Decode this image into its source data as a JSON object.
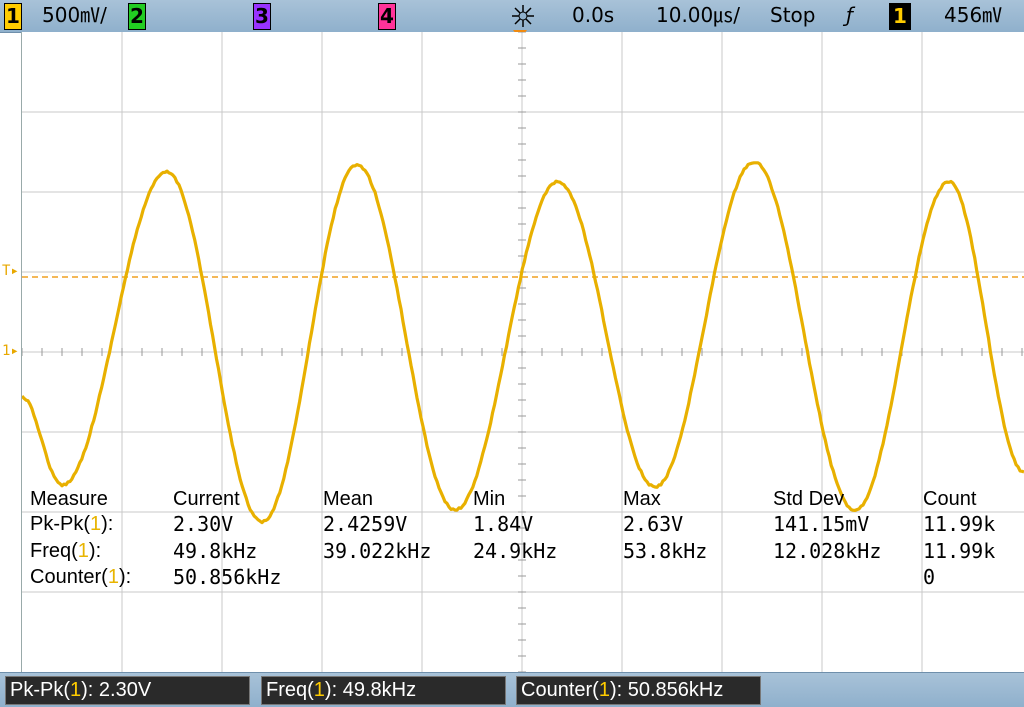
{
  "topbar": {
    "ch1_num": "1",
    "ch1_scale": "500㎷/",
    "ch2_num": "2",
    "ch3_num": "3",
    "ch4_num": "4",
    "delay": "0.0s",
    "timebase": "10.00㎲/",
    "run_state": "Stop",
    "trigger_slope": "ƒ",
    "trigger_source": "1",
    "trigger_level": "456㎷"
  },
  "markers": {
    "trigger_level_marker": "T",
    "ch1_ground_marker": "1"
  },
  "measurements": {
    "headers": [
      "Measure",
      "Current",
      "Mean",
      "Min",
      "Max",
      "Std Dev",
      "Count"
    ],
    "rows": [
      {
        "name_prefix": "Pk-Pk(",
        "src": "1",
        "name_suffix": "):",
        "current": "2.30V",
        "mean": "2.4259V",
        "min": "1.84V",
        "max": "2.63V",
        "stddev": "141.15mV",
        "count": "11.99k"
      },
      {
        "name_prefix": "Freq(",
        "src": "1",
        "name_suffix": "):",
        "current": "49.8kHz",
        "mean": "39.022kHz",
        "min": "24.9kHz",
        "max": "53.8kHz",
        "stddev": "12.028kHz",
        "count": "11.99k"
      },
      {
        "name_prefix": "Counter(",
        "src": "1",
        "name_suffix": "):",
        "current": "50.856kHz",
        "mean": "",
        "min": "",
        "max": "",
        "stddev": "",
        "count": "0"
      }
    ]
  },
  "bottombar": {
    "items": [
      {
        "prefix": "Pk-Pk(",
        "src": "1",
        "suffix": "): 2.30V"
      },
      {
        "prefix": "Freq(",
        "src": "1",
        "suffix": "): 49.8kHz"
      },
      {
        "prefix": "Counter(",
        "src": "1",
        "suffix": "): 50.856kHz"
      }
    ]
  },
  "colors": {
    "ch1": "#e8b400",
    "ch2": "#22cc22",
    "ch3": "#9933ff",
    "ch4": "#ff3399",
    "grid": "#c8c8c8",
    "trigger_line": "#f0a020"
  }
}
